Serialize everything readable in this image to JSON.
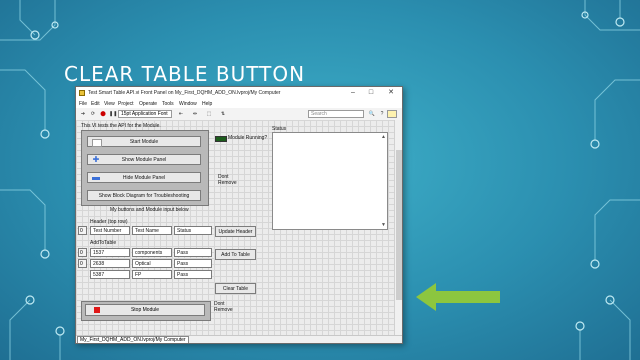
{
  "slide": {
    "title": "CLEAR TABLE BUTTON",
    "background_color": "#2b8fb0",
    "arrow_color": "#8cc63f"
  },
  "window": {
    "title": "Test Smart Table API.vi Front Panel on My_First_DQHM_ADD_ON.lvproj/My Computer",
    "controls": {
      "minimize": "–",
      "maximize": "□",
      "close": "✕"
    },
    "menu": [
      "File",
      "Edit",
      "View",
      "Project",
      "Operate",
      "Tools",
      "Window",
      "Help"
    ],
    "toolbar": {
      "font": "15pt Application Font",
      "search_placeholder": "Search"
    }
  },
  "panel": {
    "description": "This VI tests the API for the Module.",
    "buttons": {
      "start": "Start Module",
      "show_panel": "Show Module Panel",
      "hide_panel": "Hide Module Panel",
      "show_bd": "Show Block Diagram for Troubleshooting"
    },
    "group_caption": "My buttons and Module input below",
    "module_running_label": "Module Running?",
    "dont_remove": "Dont Remove",
    "status_label": "Status",
    "header": {
      "label": "Header (top row)",
      "index": "0",
      "cells": [
        "Test Number",
        "Test Name",
        "Status"
      ],
      "button": "Update Header"
    },
    "add_to_table": {
      "label": "AddToTable",
      "outer_index": "0",
      "inner_index": "0",
      "rows": [
        [
          "1537",
          "components",
          "Pass"
        ],
        [
          "2638",
          "Optical",
          "Pass"
        ],
        [
          "5387",
          "FP",
          "Pass"
        ]
      ],
      "button": "Add To Table"
    },
    "clear_button": "Clear Table",
    "dont_remove_2": "Dont Remove",
    "stop_button": "Stop Module"
  },
  "statusbar": {
    "path": "My_First_DQHM_ADD_ON.lvproj/My Computer"
  }
}
